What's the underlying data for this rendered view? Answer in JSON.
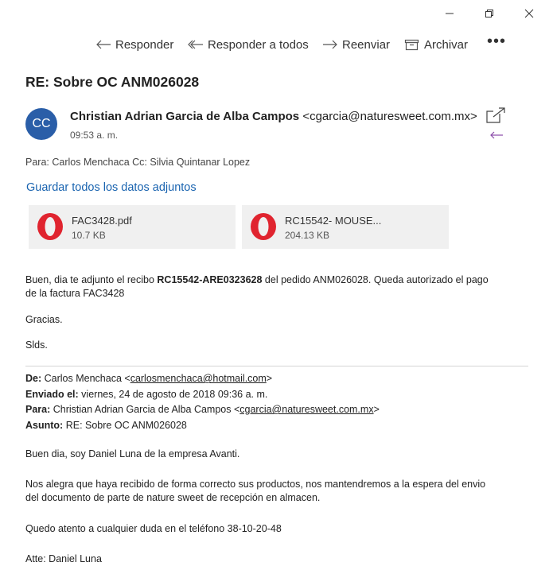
{
  "toolbar": {
    "reply_label": "Responder",
    "reply_all_label": "Responder a todos",
    "forward_label": "Reenviar",
    "archive_label": "Archivar",
    "more_label": "•••"
  },
  "message": {
    "subject": "RE: Sobre OC ANM026028",
    "avatar_initials": "CC",
    "sender_name": "Christian Adrian Garcia de Alba Campos",
    "sender_email": "<cgarcia@naturesweet.com.mx>",
    "time": "09:53 a. m.",
    "to_label": "Para:",
    "to_value": "Carlos Menchaca",
    "cc_label": "Cc:",
    "cc_value": "Silvia Quintanar Lopez",
    "save_all_label": "Guardar todos los datos adjuntos"
  },
  "attachments": [
    {
      "name": "FAC3428.pdf",
      "size": "10.7 KB",
      "icon": "opera-icon"
    },
    {
      "name": "RC15542- MOUSE...",
      "size": "204.13 KB",
      "icon": "opera-icon"
    }
  ],
  "body": {
    "line1_prefix": "Buen, dia te adjunto el recibo ",
    "line1_bold": "RC15542-ARE0323628",
    "line1_suffix": " del pedido ANM026028. Queda autorizado el pago",
    "line2": "de la factura FAC3428",
    "thanks": "Gracias.",
    "regards": "Slds."
  },
  "quoted": {
    "from_label": "De:",
    "from_name": "Carlos Menchaca <",
    "from_email": "carlosmenchaca@hotmail.com",
    "from_end": ">",
    "sent_label": "Enviado el:",
    "sent_value": "viernes, 24 de agosto de 2018 09:36 a. m.",
    "to_label": "Para:",
    "to_name": "Christian Adrian Garcia de Alba Campos <",
    "to_email": "cgarcia@naturesweet.com.mx",
    "to_end": ">",
    "subject_label": "Asunto:",
    "subject_value": "RE: Sobre OC ANM026028",
    "p1": "Buen dia, soy Daniel Luna de la empresa Avanti.",
    "p2_line1": "Nos alegra que haya recibido de forma correcto sus productos, nos mantendremos a la espera del envio",
    "p2_line2": "del documento de parte de nature sweet de recepción en almacen.",
    "p3": "Quedo atento a cualquier duda en el teléfono 38-10-20-48",
    "p4": "Atte: Daniel Luna"
  },
  "colors": {
    "accent": "#1a64b0",
    "avatar_bg": "#2a5ea8",
    "attachment_bg": "#f0f0f0",
    "opera_red": "#e0242f"
  }
}
